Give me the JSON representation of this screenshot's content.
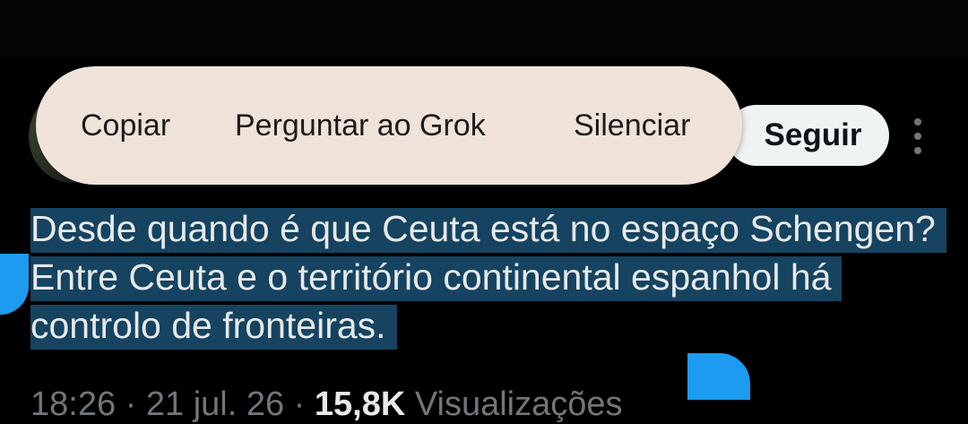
{
  "context_menu": {
    "copy_label": "Copiar",
    "ask_grok_label": "Perguntar ao Grok",
    "mute_label": "Silenciar"
  },
  "post": {
    "follow_label": "Seguir",
    "more_icon": "more-vertical-icon",
    "text": "Desde quando é que Ceuta está no espaço Schengen? Entre Ceuta e o território continental espanhol há controlo de fronteiras.",
    "time": "18:26",
    "date": "21 jul. 26",
    "separator": "·",
    "views_count": "15,8K",
    "views_label": "Visualizações"
  },
  "colors": {
    "background": "#000000",
    "menu_background": "#efe3d9",
    "selection": "#154360",
    "selection_handle": "#1d9bf0",
    "follow_button": "#eff3f4"
  }
}
